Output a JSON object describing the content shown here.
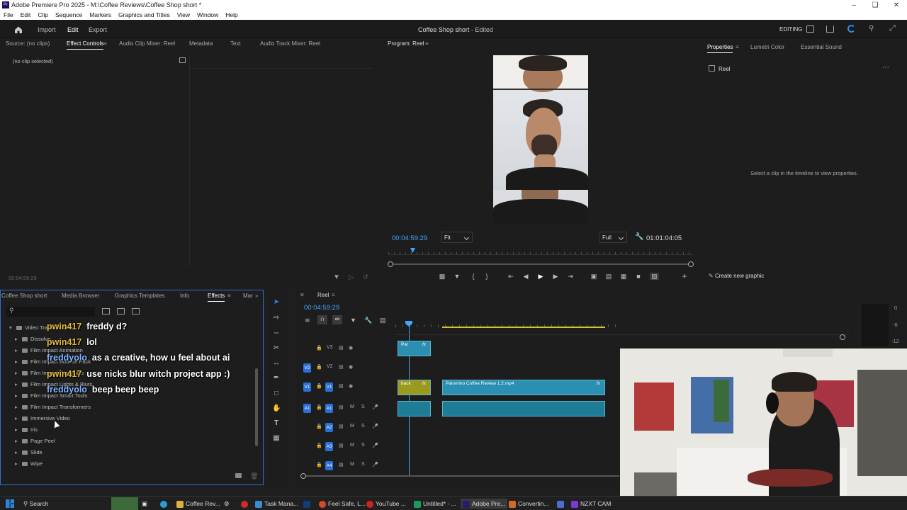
{
  "window": {
    "title": "Adobe Premiere Pro 2025 - M:\\Coffee Reviews\\Coffee Shop short *",
    "app_badge": "Pr"
  },
  "menu": [
    "File",
    "Edit",
    "Clip",
    "Sequence",
    "Markers",
    "Graphics and Titles",
    "View",
    "Window",
    "Help"
  ],
  "header": {
    "nav": [
      "Import",
      "Edit",
      "Export"
    ],
    "active_nav": "Edit",
    "project_title": "Coffee Shop short",
    "project_status": "- Edited",
    "workspace": "EDITING"
  },
  "source_panel": {
    "tabs": [
      "Source: (no clips)",
      "Effect Controls",
      "Audio Clip Mixer: Reel",
      "Metadata",
      "Text",
      "Audio Track Mixer: Reel"
    ],
    "active_tab": "Effect Controls",
    "no_clip": "(no clip selected)",
    "timecode": "00:04:59:29"
  },
  "program_monitor": {
    "title": "Program: Reel",
    "timecode": "00:04:59:29",
    "fit": "Fit",
    "quality": "Full",
    "duration": "01:01:04:05"
  },
  "properties_panel": {
    "tabs": [
      "Properties",
      "Lumetri Color",
      "Essential Sound"
    ],
    "active_tab": "Properties",
    "sequence_name": "Reel",
    "empty_message": "Select a clip in the timeline to view properties.",
    "create_button": "Create new graphic"
  },
  "effects_panel": {
    "tabs": [
      "Coffee Shop short",
      "Media Browser",
      "Graphics Templates",
      "Info",
      "Effects",
      "Mar"
    ],
    "active_tab": "Effects",
    "search_placeholder": "",
    "tree": [
      {
        "label": "Video Transitions",
        "expanded": true,
        "level": 0
      },
      {
        "label": "Dissolve",
        "level": 1
      },
      {
        "label": "Film Impact Animation",
        "level": 1
      },
      {
        "label": "Film Impact Bounce Pack",
        "level": 1
      },
      {
        "label": "Film Impact Essentials",
        "level": 1
      },
      {
        "label": "Film Impact Lights & Blurs",
        "level": 1
      },
      {
        "label": "Film Impact Smart Tools",
        "level": 1
      },
      {
        "label": "Film Impact Transformers",
        "level": 1
      },
      {
        "label": "Immersive Video",
        "level": 1
      },
      {
        "label": "Iris",
        "level": 1
      },
      {
        "label": "Page Peel",
        "level": 1
      },
      {
        "label": "Slide",
        "level": 1
      },
      {
        "label": "Wipe",
        "level": 1
      }
    ]
  },
  "chat_overlay": [
    {
      "user": "pwin417",
      "message": "freddy d?"
    },
    {
      "user": "pwin417",
      "message": "lol"
    },
    {
      "user": "freddyolo",
      "message": "as a creative, how u feel about ai"
    },
    {
      "user": "pwin417",
      "message": "use nicks blur witch project app :)"
    },
    {
      "user": "freddyolo",
      "message": "beep beep beep"
    }
  ],
  "timeline": {
    "sequence": "Reel",
    "timecode": "00:04:59:29",
    "video_tracks": [
      "V3",
      "V2",
      "V1"
    ],
    "audio_tracks": [
      "A1",
      "A2",
      "A3",
      "A4"
    ],
    "clips": {
      "v3_label": "Pal",
      "v1_small_label": "back",
      "v1_main_label": "Palomino Coffee Review 1.2.mp4",
      "fx": "fx"
    }
  },
  "meter_labels": [
    "0",
    "-6",
    "-12"
  ],
  "taskbar": {
    "search": "Search",
    "apps": [
      "Coffee Rev...",
      "Task Mana...",
      "Feel Safe, L...",
      "YouTube ...",
      "Untitled* - ...",
      "Adobe Pre...",
      "Convertin...",
      "NZXT CAM"
    ]
  }
}
